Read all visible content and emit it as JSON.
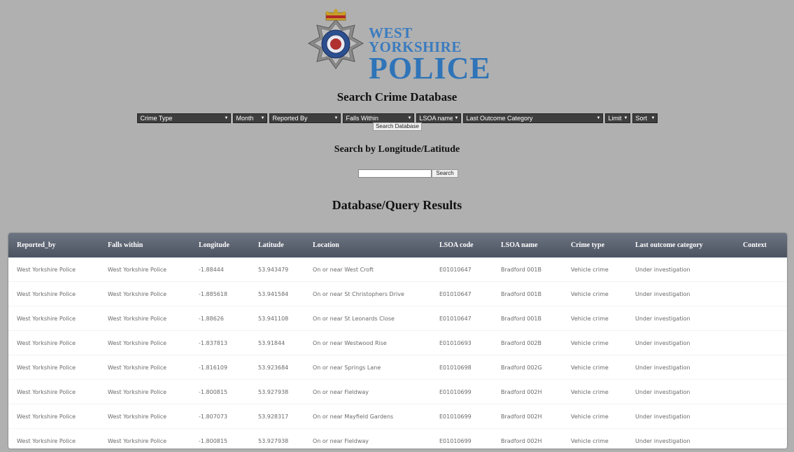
{
  "logo": {
    "line1": "WEST YORKSHIRE",
    "line2": "POLICE"
  },
  "search": {
    "title": "Search Crime Database",
    "filters": [
      {
        "label": "Crime Type"
      },
      {
        "label": "Month"
      },
      {
        "label": "Reported By"
      },
      {
        "label": "Falls Within"
      },
      {
        "label": "LSOA name"
      },
      {
        "label": "Last Outcome Category"
      },
      {
        "label": "Limit"
      },
      {
        "label": "Sort"
      }
    ],
    "button": "Search Database"
  },
  "geo": {
    "title": "Search by Longitude/Latitude",
    "input_value": "",
    "button": "Search"
  },
  "results": {
    "title": "Database/Query Results",
    "columns": [
      "Reported_by",
      "Falls within",
      "Longitude",
      "Latitude",
      "Location",
      "LSOA code",
      "LSOA name",
      "Crime type",
      "Last outcome category",
      "Context"
    ],
    "rows": [
      [
        "West Yorkshire Police",
        "West Yorkshire Police",
        "-1.88444",
        "53.943479",
        "On or near West Croft",
        "E01010647",
        "Bradford 001B",
        "Vehicle crime",
        "Under investigation",
        ""
      ],
      [
        "West Yorkshire Police",
        "West Yorkshire Police",
        "-1.885618",
        "53.941584",
        "On or near St Christophers Drive",
        "E01010647",
        "Bradford 001B",
        "Vehicle crime",
        "Under investigation",
        ""
      ],
      [
        "West Yorkshire Police",
        "West Yorkshire Police",
        "-1.88626",
        "53.941108",
        "On or near St Leonards Close",
        "E01010647",
        "Bradford 001B",
        "Vehicle crime",
        "Under investigation",
        ""
      ],
      [
        "West Yorkshire Police",
        "West Yorkshire Police",
        "-1.837813",
        "53.91844",
        "On or near Westwood Rise",
        "E01010693",
        "Bradford 002B",
        "Vehicle crime",
        "Under investigation",
        ""
      ],
      [
        "West Yorkshire Police",
        "West Yorkshire Police",
        "-1.816109",
        "53.923684",
        "On or near Springs Lane",
        "E01010698",
        "Bradford 002G",
        "Vehicle crime",
        "Under investigation",
        ""
      ],
      [
        "West Yorkshire Police",
        "West Yorkshire Police",
        "-1.800815",
        "53.927938",
        "On or near Fieldway",
        "E01010699",
        "Bradford 002H",
        "Vehicle crime",
        "Under investigation",
        ""
      ],
      [
        "West Yorkshire Police",
        "West Yorkshire Police",
        "-1.807073",
        "53.928317",
        "On or near Mayfield Gardens",
        "E01010699",
        "Bradford 002H",
        "Vehicle crime",
        "Under investigation",
        ""
      ],
      [
        "West Yorkshire Police",
        "West Yorkshire Police",
        "-1.800815",
        "53.927938",
        "On or near Fieldway",
        "E01010699",
        "Bradford 002H",
        "Vehicle crime",
        "Under investigation",
        ""
      ]
    ]
  },
  "colors": {
    "page_bg": "#b0b0b0",
    "logo_blue": "#2f74b8",
    "header_bg": "#4b5260"
  }
}
